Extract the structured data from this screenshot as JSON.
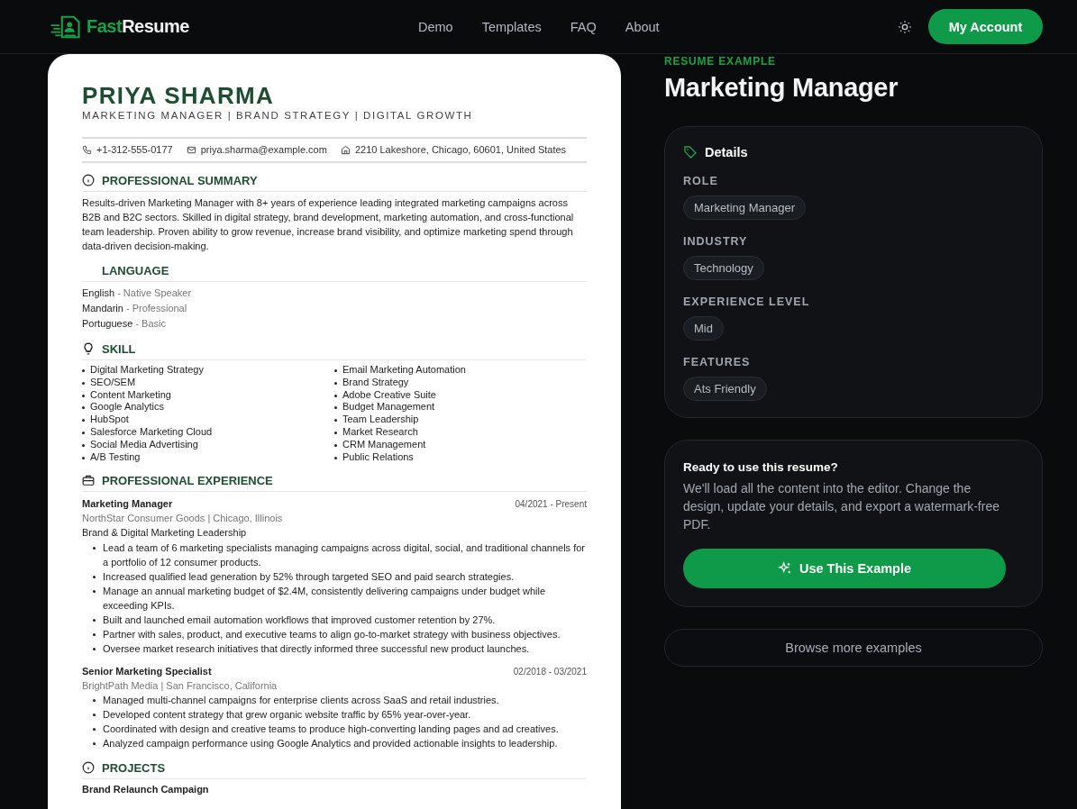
{
  "header": {
    "logo": {
      "first": "Fast",
      "second": "Resume"
    },
    "nav": [
      {
        "label": "Demo"
      },
      {
        "label": "Templates"
      },
      {
        "label": "FAQ"
      },
      {
        "label": "About"
      }
    ],
    "account_button": "My Account"
  },
  "resume": {
    "name": "PRIYA SHARMA",
    "headline": "MARKETING MANAGER | BRAND STRATEGY | DIGITAL GROWTH",
    "contacts": [
      {
        "kind": "phone",
        "text": "+1-312-555-0177"
      },
      {
        "kind": "email",
        "text": "priya.sharma@example.com"
      },
      {
        "kind": "address",
        "text": "2210 Lakeshore, Chicago, 60601, United States"
      }
    ],
    "sections": [
      {
        "kind": "summary",
        "title": "PROFESSIONAL SUMMARY",
        "text": "Results-driven Marketing Manager with 8+ years of experience leading integrated marketing campaigns across B2B and B2C sectors. Skilled in digital strategy, brand development, marketing automation, and cross-functional team leadership. Proven ability to grow revenue, increase brand visibility, and optimize marketing spend through data-driven decision-making."
      },
      {
        "kind": "language",
        "title": "LANGUAGE",
        "items": [
          {
            "name": "English",
            "level": "- Native Speaker"
          },
          {
            "name": "Mandarin",
            "level": "- Professional"
          },
          {
            "name": "Portuguese",
            "level": "- Basic"
          }
        ]
      },
      {
        "kind": "skills",
        "title": "SKILL",
        "items": [
          "Digital Marketing Strategy",
          "SEO/SEM",
          "Content Marketing",
          "Google Analytics",
          "HubSpot",
          "Salesforce Marketing Cloud",
          "Social Media Advertising",
          "A/B Testing",
          "Email Marketing Automation",
          "Brand Strategy",
          "Adobe Creative Suite",
          "Budget Management",
          "Team Leadership",
          "Market Research",
          "CRM Management",
          "Public Relations"
        ]
      },
      {
        "kind": "experience",
        "title": "PROFESSIONAL EXPERIENCE",
        "items": [
          {
            "title": "Marketing Manager",
            "dates": "04/2021 - Present",
            "company": "NorthStar Consumer Goods | Chicago, Illinois",
            "subtitle": "Brand & Digital Marketing Leadership",
            "bullets": [
              "Lead a team of 6 marketing specialists managing campaigns across digital, social, and traditional channels for a portfolio of 12 consumer products.",
              "Increased qualified lead generation by 52% through targeted SEO and paid search strategies.",
              "Manage an annual marketing budget of $2.4M, consistently delivering campaigns under budget while exceeding KPIs.",
              "Built and launched email automation workflows that improved customer retention by 27%.",
              "Partner with sales, product, and executive teams to align go-to-market strategy with business objectives.",
              "Oversee market research initiatives that directly informed three successful new product launches."
            ]
          },
          {
            "title": "Senior Marketing Specialist",
            "dates": "02/2018 - 03/2021",
            "company": "BrightPath Media | San Francisco, California",
            "bullets": [
              "Managed multi-channel campaigns for enterprise clients across SaaS and retail industries.",
              "Developed content strategy that grew organic website traffic by 65% year-over-year.",
              "Coordinated with design and creative teams to produce high-converting landing pages and ad creatives.",
              "Analyzed campaign performance using Google Analytics and provided actionable insights to leadership."
            ]
          }
        ]
      },
      {
        "kind": "projects",
        "title": "PROJECTS",
        "items": [
          {
            "title": "Brand Relaunch Campaign"
          }
        ]
      }
    ]
  },
  "example": {
    "eyebrow": "RESUME EXAMPLE",
    "title": "Marketing Manager",
    "details": {
      "title": "Details",
      "groups": [
        {
          "label": "ROLE",
          "tags": [
            "Marketing Manager"
          ]
        },
        {
          "label": "INDUSTRY",
          "tags": [
            "Technology"
          ]
        },
        {
          "label": "EXPERIENCE LEVEL",
          "tags": [
            "Mid"
          ]
        },
        {
          "label": "FEATURES",
          "tags": [
            "Ats Friendly"
          ]
        }
      ]
    },
    "cta": {
      "title": "Ready to use this resume?",
      "text": "We'll load all the content into the editor. Change the design, update your details, and export a watermark-free PDF.",
      "button": "Use This Example"
    },
    "browse_button": "Browse more examples"
  }
}
